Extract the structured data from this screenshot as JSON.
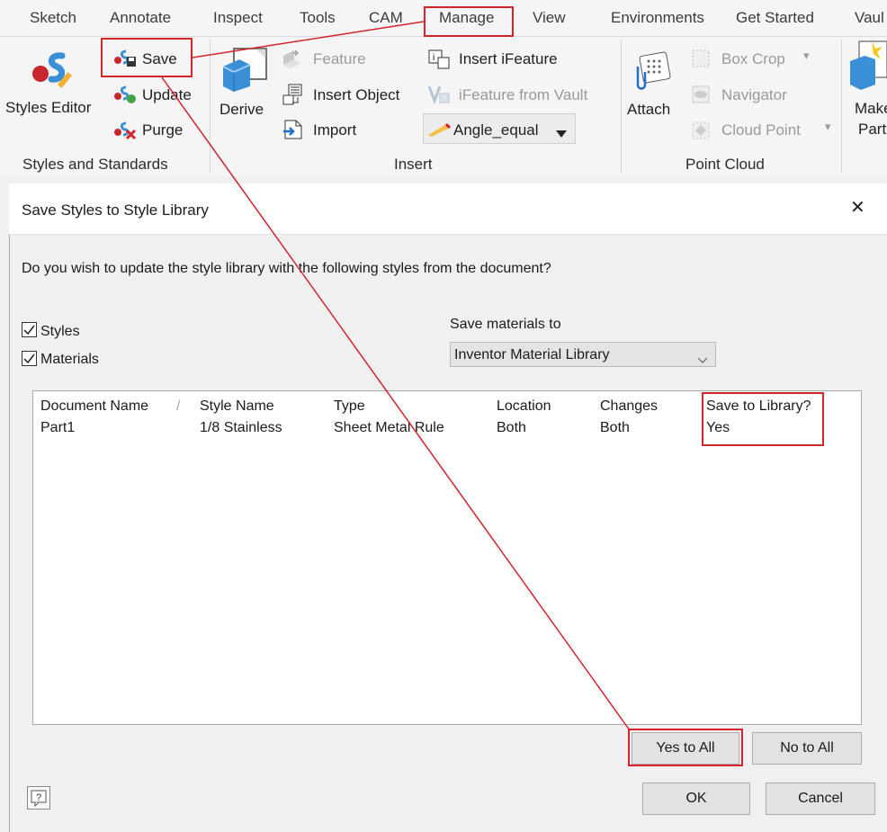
{
  "ribbon": {
    "tabs": [
      "Sketch",
      "Annotate",
      "Inspect",
      "Tools",
      "CAM",
      "Manage",
      "View",
      "Environments",
      "Get Started",
      "Vaul"
    ],
    "active_tab": "Manage",
    "styles_group": {
      "styles_editor": "Styles Editor",
      "save": "Save",
      "update": "Update",
      "purge": "Purge",
      "label": "Styles and Standards"
    },
    "insert_group": {
      "derive": "Derive",
      "feature": "Feature",
      "insert_object": "Insert Object",
      "import": "Import",
      "insert_ifeature": "Insert iFeature",
      "ifeature_from_vault": "iFeature from Vault",
      "angle_equal": "Angle_equal",
      "label": "Insert"
    },
    "point_cloud_group": {
      "attach": "Attach",
      "box_crop": "Box Crop",
      "navigator": "Navigator",
      "cloud_point": "Cloud Point",
      "label": "Point Cloud"
    },
    "make_part": [
      "Make",
      "Part"
    ]
  },
  "dialog": {
    "title": "Save Styles to Style Library",
    "close_glyph": "✕",
    "question": "Do you wish to update the style library with the following styles from the document?",
    "styles_checkbox": {
      "label": "Styles",
      "checked": true
    },
    "materials_checkbox": {
      "label": "Materials",
      "checked": true
    },
    "save_materials_label": "Save materials to",
    "save_materials_value": "Inventor Material Library",
    "table": {
      "columns": [
        "Document Name",
        "Style Name",
        "Type",
        "Location",
        "Changes",
        "Save to Library?"
      ],
      "rows": [
        [
          "Part1",
          "1/8 Stainless",
          "Sheet Metal Rule",
          "Both",
          "Both",
          "Yes"
        ]
      ]
    },
    "yes_to_all": "Yes to All",
    "no_to_all": "No to All",
    "ok": "OK",
    "cancel": "Cancel",
    "help_glyph": "?"
  },
  "colors": {
    "annotation_red": "#d4232b",
    "icon_blue": "#3b8fd6",
    "icon_red": "#c8262e"
  }
}
